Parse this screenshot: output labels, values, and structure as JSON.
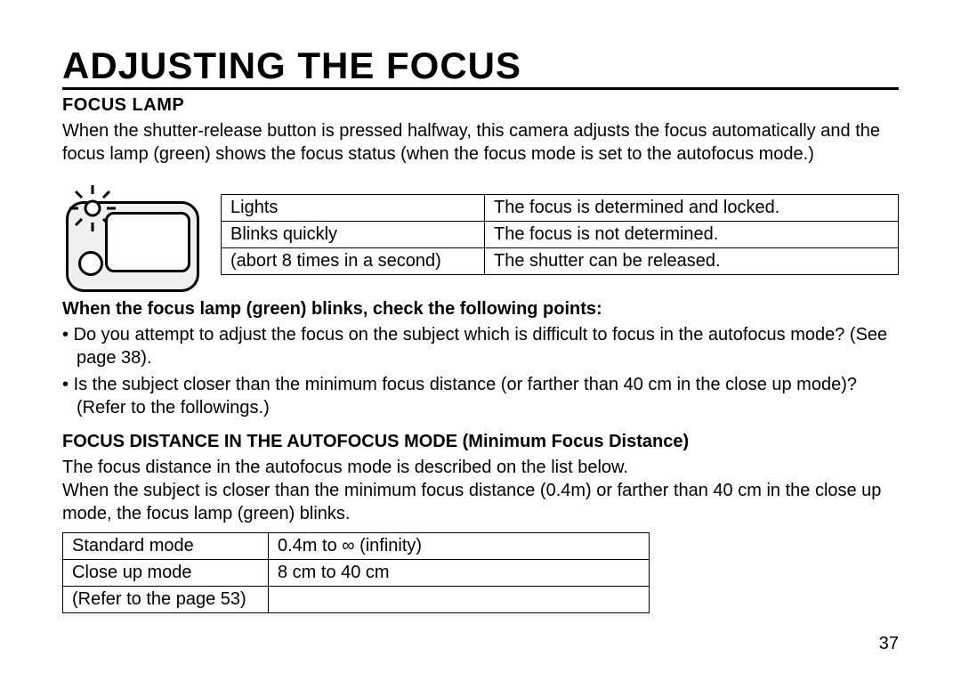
{
  "title": "ADJUSTING THE FOCUS",
  "section1_heading": "FOCUS LAMP",
  "section1_body": "When the shutter-release button is pressed halfway, this camera adjusts the focus automatically and the focus lamp (green) shows the focus status (when the focus mode is set to the autofocus mode.)",
  "table1": {
    "r1c1": "Lights",
    "r1c2": "The focus is determined and locked.",
    "r2c1": "Blinks quickly",
    "r2c2": "The focus is not determined.",
    "r3c1": "(abort 8 times in a second)",
    "r3c2": "The shutter can be released."
  },
  "check_heading": "When the focus lamp (green) blinks, check the following points:",
  "bullets": {
    "b1": "Do you attempt to adjust the focus on the subject which is difficult to focus in the autofocus mode? (See page 38).",
    "b2": "Is the subject closer than the minimum focus distance (or farther than 40 cm in the close up mode)? (Refer to the followings.)"
  },
  "section2_heading": "FOCUS DISTANCE IN THE AUTOFOCUS MODE (Minimum Focus Distance)",
  "section2_body": "The focus distance in the autofocus mode is described on the list below.\nWhen the subject is closer than the minimum focus distance (0.4m) or farther than 40 cm in the close up mode, the focus lamp (green) blinks.",
  "table2": {
    "r1c1": "Standard mode",
    "r1c2": "0.4m to ∞ (infinity)",
    "r2c1": "Close up mode",
    "r2c2": "8 cm to 40 cm",
    "r3c1": "(Refer to the page 53)",
    "r3c2": ""
  },
  "page_number": "37"
}
